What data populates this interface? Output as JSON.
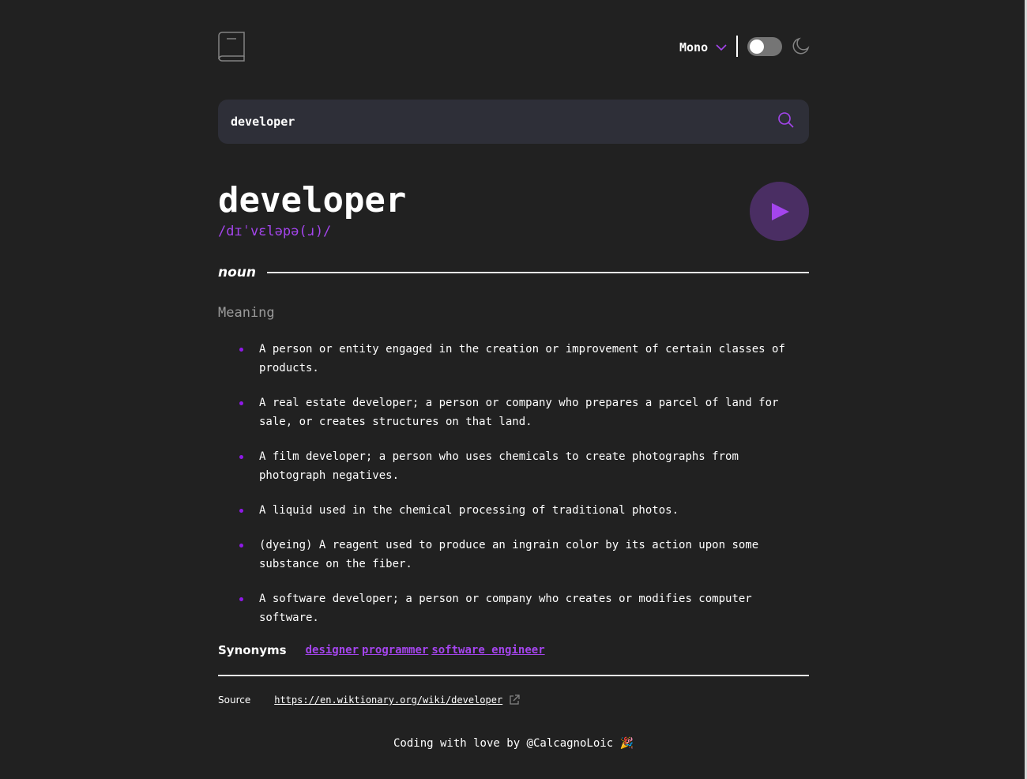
{
  "header": {
    "logo_icon": "book-icon",
    "font": {
      "selected": "Mono",
      "icon": "chevron-down-icon"
    },
    "theme": {
      "dark_mode": true,
      "icon": "moon-icon"
    }
  },
  "search": {
    "value": "developer",
    "icon": "search-icon"
  },
  "entry": {
    "word": "developer",
    "phonetic": "/dɪˈvɛləpə(ɹ)/",
    "play_icon": "play-icon",
    "part_of_speech": "noun",
    "meaning_heading": "Meaning",
    "definitions": [
      "A person or entity engaged in the creation or improvement of certain classes of products.",
      "A real estate developer; a person or company who prepares a parcel of land for sale, or creates structures on that land.",
      "A film developer; a person who uses chemicals to create photographs from photograph negatives.",
      "A liquid used in the chemical processing of traditional photos.",
      "(dyeing) A reagent used to produce an ingrain color by its action upon some substance on the fiber.",
      "A software developer; a person or company who creates or modifies computer software."
    ],
    "synonyms_label": "Synonyms",
    "synonyms": [
      "designer",
      "programmer",
      "software engineer"
    ]
  },
  "source": {
    "label": "Source",
    "url": "https://en.wiktionary.org/wiki/developer",
    "icon": "external-link-icon"
  },
  "footer": {
    "text": "Coding with love by @CalcagnoLoic 🎉"
  },
  "colors": {
    "background": "#212121",
    "accent": "#a445ed",
    "search_bg": "#2e2f38",
    "play_bg": "#4a2e63",
    "muted": "#9a9a9a"
  }
}
